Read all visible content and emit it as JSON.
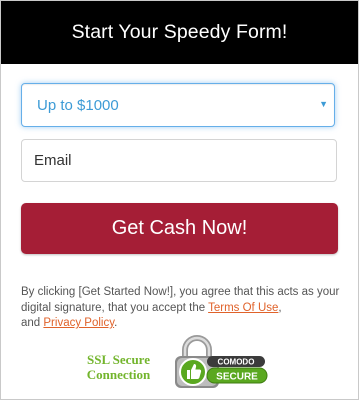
{
  "header": {
    "title": "Start Your Speedy Form!"
  },
  "form": {
    "amount_select": {
      "selected": "Up to $1000",
      "caret": "▼"
    },
    "email_field": {
      "placeholder": "Email"
    },
    "submit_label": "Get Cash Now!"
  },
  "disclaimer": {
    "text_before": "By clicking [Get Started Now!], you agree that this acts as your digital signature, that you accept the ",
    "terms_link": "Terms Of Use",
    "text_middle": ",",
    "text_and": " and ",
    "privacy_link": "Privacy Policy",
    "text_end": "."
  },
  "security": {
    "ssl_label_line1": "SSL Secure",
    "ssl_label_line2": "Connection",
    "seal_brand": "COMODO",
    "seal_word": "SECURE"
  },
  "colors": {
    "header_bg": "#000000",
    "accent_blue": "#3d9bd6",
    "cta_red": "#a51e36",
    "link_orange": "#e0622a",
    "ssl_green": "#73b52d"
  }
}
